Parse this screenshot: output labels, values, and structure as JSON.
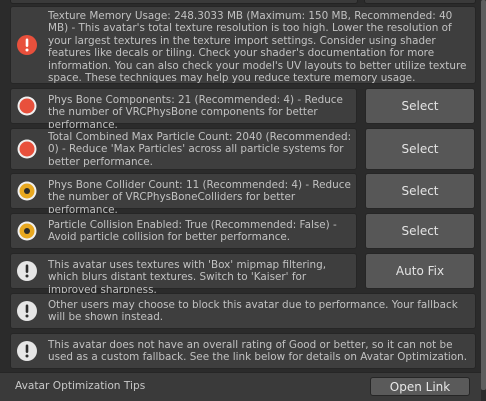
{
  "messages": [
    {
      "severity": "error",
      "text": "Texture Memory Usage: 248.3033 MB (Maximum: 150 MB, Recommended: 40 MB) - This avatar's total texture resolution is too high. Lower the resolution of your largest textures in the texture import settings. Consider using shader features like decals or tiling. Check your shader's documentation for more information. You can also check your model's UV layouts to better utilize texture space. These techniques may help you reduce texture memory usage.",
      "button": ""
    },
    {
      "severity": "error",
      "text": "Phys Bone Components: 21 (Recommended: 4) - Reduce the number of VRCPhysBone components for better performance.",
      "button": "Select"
    },
    {
      "severity": "error",
      "text": "Total Combined Max Particle Count: 2040 (Recommended: 0) - Reduce 'Max Particles' across all particle systems for better performance.",
      "button": "Select"
    },
    {
      "severity": "warning",
      "text": "Phys Bone Collider Count: 11 (Recommended: 4) - Reduce the number of VRCPhysBoneColliders for better performance.",
      "button": "Select"
    },
    {
      "severity": "warning",
      "text": "Particle Collision Enabled: True (Recommended: False) - Avoid particle collision for better performance.",
      "button": "Select"
    },
    {
      "severity": "info",
      "text": "This avatar uses textures with 'Box' mipmap filtering, which blurs distant textures. Switch to 'Kaiser' for improved sharpness.",
      "button": "Auto Fix"
    },
    {
      "severity": "info",
      "text": "Other users may choose to block this avatar due to performance. Your fallback will be shown instead.",
      "button": ""
    },
    {
      "severity": "info",
      "text": "This avatar does not have an overall rating of Good or better, so it can not be used as a custom fallback. See the link below for details on Avatar Optimization.",
      "button": ""
    }
  ],
  "footer": {
    "label": "Avatar Optimization Tips",
    "button": "Open Link"
  },
  "colors": {
    "error": "#e8503c",
    "warning": "#e8a820",
    "info": "#e6e6e6"
  }
}
